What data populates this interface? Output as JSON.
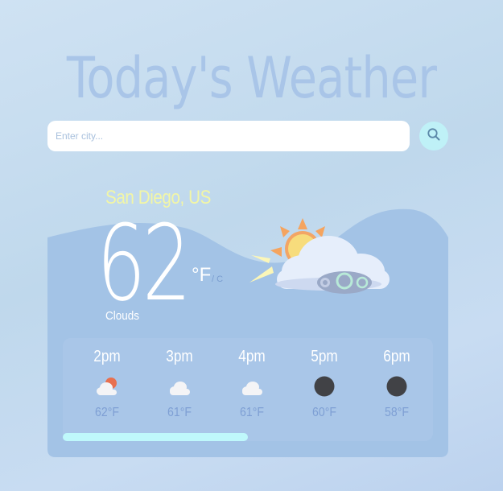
{
  "app": {
    "title": "Today's Weather"
  },
  "search": {
    "placeholder": "Enter city...",
    "value": "",
    "button_icon": "search-icon"
  },
  "current": {
    "location": "San Diego, US",
    "temperature": "62",
    "unit_primary": "°F",
    "unit_secondary": "/ C",
    "condition": "Clouds",
    "icon": "sun-cloud-wind-icon"
  },
  "forecast": [
    {
      "time": "2pm",
      "icon": "cloud-sun-icon",
      "temp": "62°F"
    },
    {
      "time": "3pm",
      "icon": "cloud-icon",
      "temp": "61°F"
    },
    {
      "time": "4pm",
      "icon": "cloud-icon",
      "temp": "61°F"
    },
    {
      "time": "5pm",
      "icon": "dark-circle-icon",
      "temp": "60°F"
    },
    {
      "time": "6pm",
      "icon": "dark-circle-icon",
      "temp": "58°F"
    }
  ],
  "forecast_scroll_fraction": 0.5,
  "colors": {
    "title": "#a9c5e8",
    "location": "#f2f6a6",
    "card": "#a3c3e6",
    "forecast_panel": "#a9c6e8",
    "search_button": "#bff1f7",
    "scroll_thumb": "#bff8fb",
    "hour_temp": "#7e9fd4"
  }
}
